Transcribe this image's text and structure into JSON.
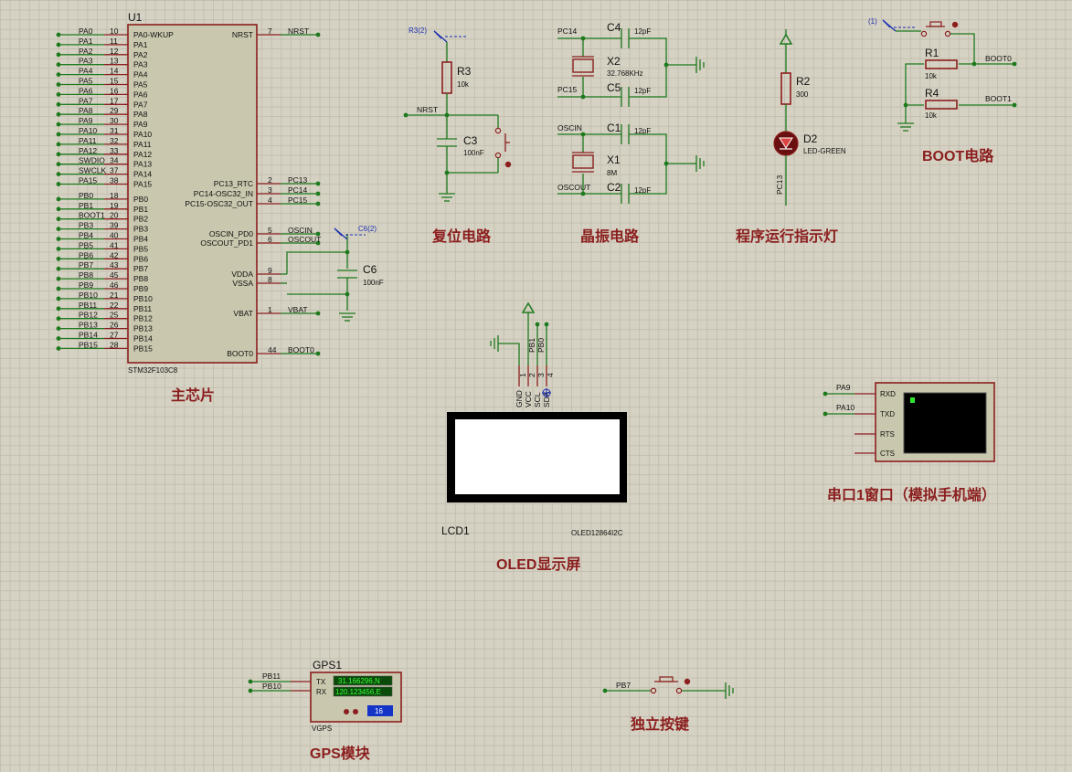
{
  "u1": {
    "ref": "U1",
    "part": "STM32F103C8",
    "left_pins": [
      {
        "net": "PA0",
        "num": "10",
        "name": "PA0-WKUP"
      },
      {
        "net": "PA1",
        "num": "11",
        "name": "PA1"
      },
      {
        "net": "PA2",
        "num": "12",
        "name": "PA2"
      },
      {
        "net": "PA3",
        "num": "13",
        "name": "PA3"
      },
      {
        "net": "PA4",
        "num": "14",
        "name": "PA4"
      },
      {
        "net": "PA5",
        "num": "15",
        "name": "PA5"
      },
      {
        "net": "PA6",
        "num": "16",
        "name": "PA6"
      },
      {
        "net": "PA7",
        "num": "17",
        "name": "PA7"
      },
      {
        "net": "PA8",
        "num": "29",
        "name": "PA8"
      },
      {
        "net": "PA9",
        "num": "30",
        "name": "PA9"
      },
      {
        "net": "PA10",
        "num": "31",
        "name": "PA10"
      },
      {
        "net": "PA11",
        "num": "32",
        "name": "PA11"
      },
      {
        "net": "PA12",
        "num": "33",
        "name": "PA12"
      },
      {
        "net": "SWDIO",
        "num": "34",
        "name": "PA13"
      },
      {
        "net": "SWCLK",
        "num": "37",
        "name": "PA14"
      },
      {
        "net": "PA15",
        "num": "38",
        "name": "PA15"
      },
      {
        "net": "PB0",
        "num": "18",
        "name": "PB0"
      },
      {
        "net": "PB1",
        "num": "19",
        "name": "PB1"
      },
      {
        "net": "BOOT1",
        "num": "20",
        "name": "PB2"
      },
      {
        "net": "PB3",
        "num": "39",
        "name": "PB3"
      },
      {
        "net": "PB4",
        "num": "40",
        "name": "PB4"
      },
      {
        "net": "PB5",
        "num": "41",
        "name": "PB5"
      },
      {
        "net": "PB6",
        "num": "42",
        "name": "PB6"
      },
      {
        "net": "PB7",
        "num": "43",
        "name": "PB7"
      },
      {
        "net": "PB8",
        "num": "45",
        "name": "PB8"
      },
      {
        "net": "PB9",
        "num": "46",
        "name": "PB9"
      },
      {
        "net": "PB10",
        "num": "21",
        "name": "PB10"
      },
      {
        "net": "PB11",
        "num": "22",
        "name": "PB11"
      },
      {
        "net": "PB12",
        "num": "25",
        "name": "PB12"
      },
      {
        "net": "PB13",
        "num": "26",
        "name": "PB13"
      },
      {
        "net": "PB14",
        "num": "27",
        "name": "PB14"
      },
      {
        "net": "PB15",
        "num": "28",
        "name": "PB15"
      }
    ],
    "right_pins": [
      {
        "name": "NRST",
        "num": "7",
        "net": "NRST"
      },
      {
        "name": "PC13_RTC",
        "num": "2",
        "net": "PC13"
      },
      {
        "name": "PC14-OSC32_IN",
        "num": "3",
        "net": "PC14"
      },
      {
        "name": "PC15-OSC32_OUT",
        "num": "4",
        "net": "PC15"
      },
      {
        "name": "OSCIN_PD0",
        "num": "5",
        "net": "OSCIN"
      },
      {
        "name": "OSCOUT_PD1",
        "num": "6",
        "net": "OSCOUT"
      },
      {
        "name": "VDDA",
        "num": "9",
        "net": ""
      },
      {
        "name": "VSSA",
        "num": "8",
        "net": ""
      },
      {
        "name": "VBAT",
        "num": "1",
        "net": "VBAT"
      },
      {
        "name": "BOOT0",
        "num": "44",
        "net": "BOOT0"
      }
    ],
    "c6": {
      "ref": "C6",
      "value": "100nF",
      "probe": "C6(2)"
    },
    "caption": "主芯片"
  },
  "reset": {
    "probe": "R3(2)",
    "r3": {
      "ref": "R3",
      "value": "10k"
    },
    "c3": {
      "ref": "C3",
      "value": "100nF"
    },
    "net": "NRST",
    "caption": "复位电路"
  },
  "crystal": {
    "c4": {
      "ref": "C4",
      "value": "12pF"
    },
    "c5": {
      "ref": "C5",
      "value": "12pF"
    },
    "x2": {
      "ref": "X2",
      "value": "32.768KHz"
    },
    "c1": {
      "ref": "C1",
      "value": "12pF"
    },
    "c2": {
      "ref": "C2",
      "value": "12pF"
    },
    "x1": {
      "ref": "X1",
      "value": "8M"
    },
    "nets": {
      "pc14": "PC14",
      "pc15": "PC15",
      "oscin": "OSCIN",
      "oscout": "OSCOUT"
    },
    "caption": "晶振电路"
  },
  "led": {
    "r2": {
      "ref": "R2",
      "value": "300"
    },
    "d2": {
      "ref": "D2",
      "value": "LED-GREEN"
    },
    "net": "PC13",
    "caption": "程序运行指示灯"
  },
  "boot": {
    "probe": "(1)",
    "r1": {
      "ref": "R1",
      "value": "10k"
    },
    "r4": {
      "ref": "R4",
      "value": "10k"
    },
    "boot0": "BOOT0",
    "boot1": "BOOT1",
    "caption": "BOOT电路"
  },
  "oled": {
    "pins": [
      {
        "num": "1",
        "name": "GND"
      },
      {
        "num": "2",
        "name": "VCC"
      },
      {
        "num": "3",
        "name": "SCL"
      },
      {
        "num": "4",
        "name": "SDA"
      }
    ],
    "net_scl": "PB1",
    "net_sda": "PB0",
    "ref": "LCD1",
    "part": "OLED12864I2C",
    "caption": "OLED显示屏"
  },
  "uart": {
    "net_rx": "PA9",
    "net_tx": "PA10",
    "pins": [
      "RXD",
      "TXD",
      "RTS",
      "CTS"
    ],
    "caption": "串口1窗口（模拟手机端）"
  },
  "gps": {
    "ref": "GPS1",
    "part": "VGPS",
    "net_tx": "PB11",
    "net_rx": "PB10",
    "pin_tx": "TX",
    "pin_rx": "RX",
    "lat": "31.166296,N",
    "lon": "120.123456,E",
    "count": "16",
    "caption": "GPS模块"
  },
  "key": {
    "net": "PB7",
    "caption": "独立按键"
  }
}
